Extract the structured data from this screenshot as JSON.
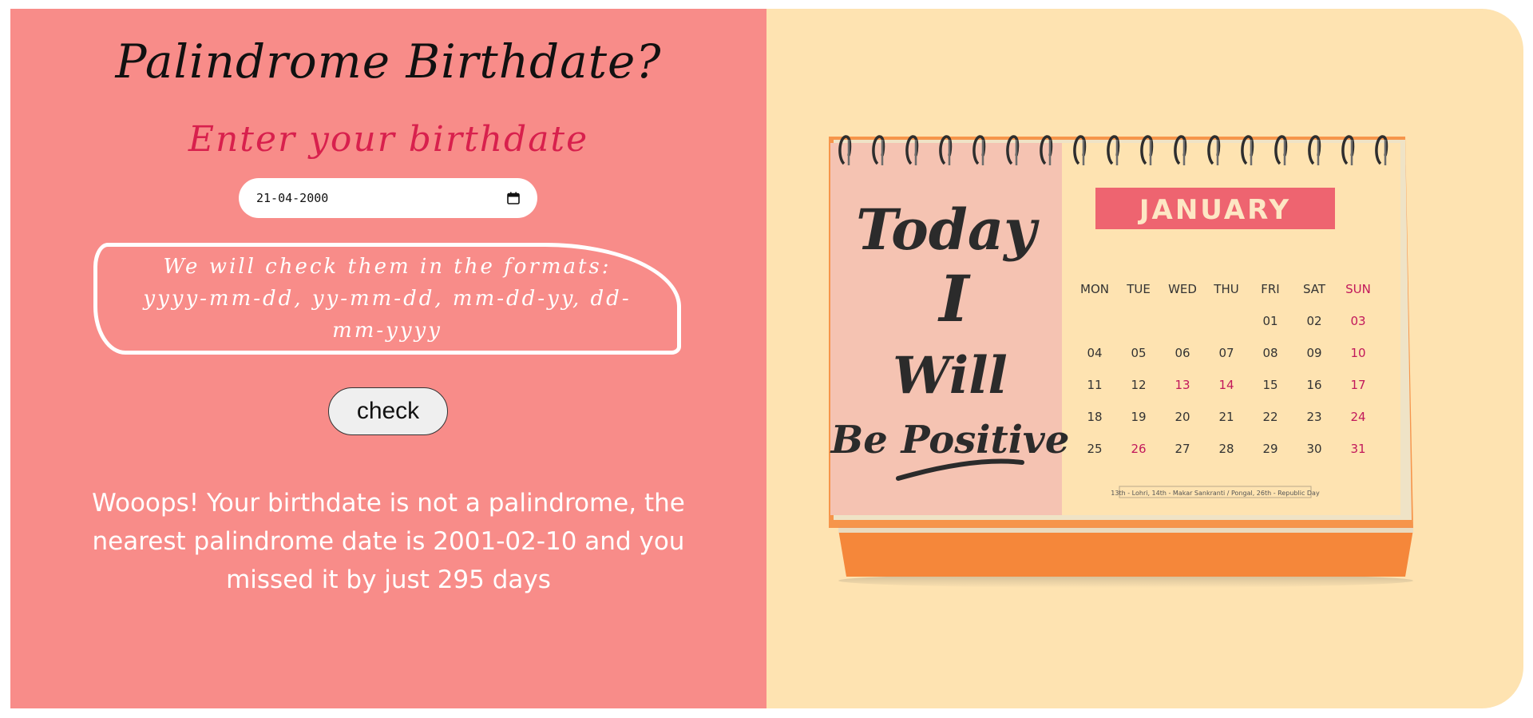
{
  "header": {
    "title": "Palindrome Birthdate?",
    "subtitle": "Enter your birthdate"
  },
  "form": {
    "date_value": "21-04-2000",
    "formats_note": "We will check them in the formats: yyyy-mm-dd, yy-mm-dd, mm-dd-yy, dd-mm-yyyy",
    "check_label": "check"
  },
  "result": {
    "message": "Wooops! Your birthdate is not a palindrome, the nearest palindrome date is 2001-02-10 and you missed it by just 295 days"
  },
  "illustration": {
    "quote_line1": "Today",
    "quote_line2": "I",
    "quote_line3": "Will",
    "quote_line4": "Be Positive",
    "month": "JANUARY",
    "weekdays": [
      "MON",
      "TUE",
      "WED",
      "THU",
      "FRI",
      "SAT",
      "SUN"
    ],
    "weeks": [
      [
        "",
        "",
        "",
        "",
        "01",
        "02",
        "03"
      ],
      [
        "04",
        "05",
        "06",
        "07",
        "08",
        "09",
        "10"
      ],
      [
        "11",
        "12",
        "13",
        "14",
        "15",
        "16",
        "17"
      ],
      [
        "18",
        "19",
        "20",
        "21",
        "22",
        "23",
        "24"
      ],
      [
        "25",
        "26",
        "27",
        "28",
        "29",
        "30",
        "31"
      ]
    ],
    "highlighted_days": [
      "03",
      "10",
      "13",
      "14",
      "17",
      "24",
      "26",
      "31"
    ],
    "holidays_note": "13th - Lohri, 14th - Makar Sankranti / Pongal, 26th - Republic Day"
  },
  "colors": {
    "left_bg": "#f88c89",
    "right_bg": "#fee3b1",
    "subtitle": "#d8204d",
    "calendar_base": "#f5873a",
    "month_banner": "#ee6470",
    "holiday_text": "#c2185b"
  }
}
